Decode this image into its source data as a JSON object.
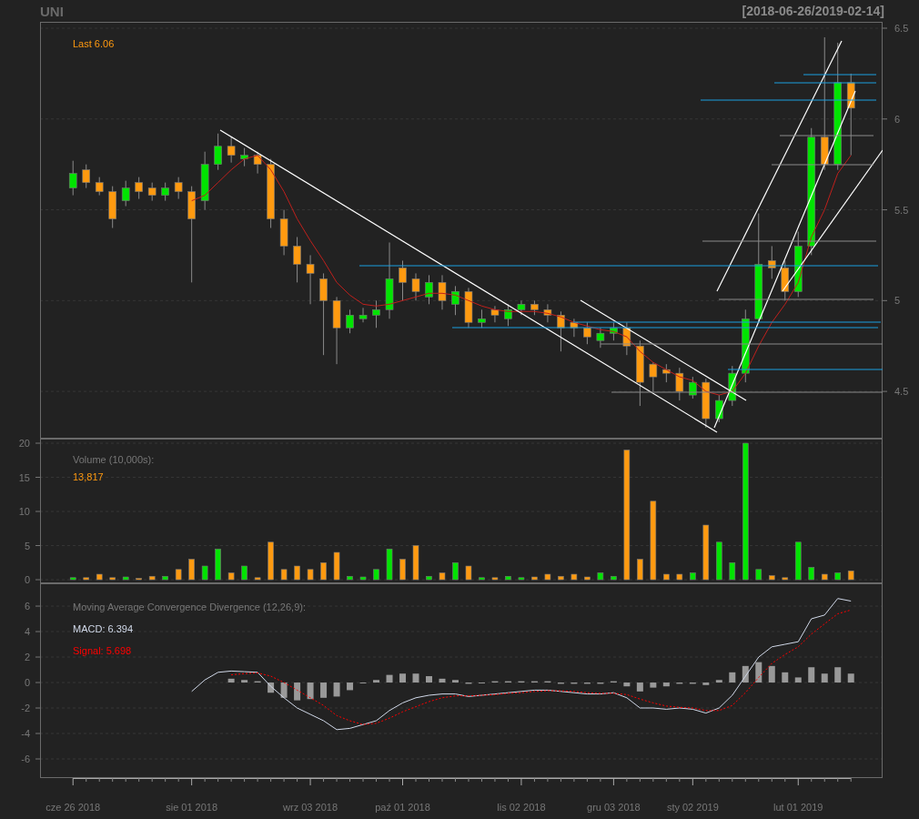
{
  "header": {
    "symbol": "UNI",
    "range": "[2018-06-26/2019-02-14]"
  },
  "price_panel": {
    "legend": "Last 6.06",
    "chart_data": {
      "type": "candlestick",
      "grid": true,
      "ylim": [
        4.24,
        6.535
      ],
      "yticks": [
        4.5,
        5.0,
        5.5,
        6.0,
        6.5
      ],
      "ohlc": [
        [
          5.62,
          5.77,
          5.58,
          5.7
        ],
        [
          5.72,
          5.75,
          5.62,
          5.65
        ],
        [
          5.65,
          5.68,
          5.58,
          5.6
        ],
        [
          5.6,
          5.63,
          5.4,
          5.45
        ],
        [
          5.55,
          5.66,
          5.52,
          5.62
        ],
        [
          5.65,
          5.68,
          5.56,
          5.6
        ],
        [
          5.62,
          5.65,
          5.55,
          5.58
        ],
        [
          5.58,
          5.65,
          5.55,
          5.62
        ],
        [
          5.65,
          5.68,
          5.56,
          5.6
        ],
        [
          5.6,
          5.63,
          5.1,
          5.45
        ],
        [
          5.55,
          5.82,
          5.5,
          5.75
        ],
        [
          5.75,
          5.92,
          5.72,
          5.85
        ],
        [
          5.85,
          5.9,
          5.76,
          5.8
        ],
        [
          5.78,
          5.84,
          5.74,
          5.8
        ],
        [
          5.8,
          5.82,
          5.7,
          5.75
        ],
        [
          5.75,
          5.78,
          5.4,
          5.45
        ],
        [
          5.45,
          5.5,
          5.25,
          5.3
        ],
        [
          5.3,
          5.35,
          5.1,
          5.2
        ],
        [
          5.2,
          5.25,
          4.98,
          5.15
        ],
        [
          5.12,
          5.15,
          4.7,
          5.0
        ],
        [
          5.0,
          5.02,
          4.65,
          4.85
        ],
        [
          4.85,
          4.95,
          4.82,
          4.92
        ],
        [
          4.9,
          4.96,
          4.88,
          4.92
        ],
        [
          4.92,
          5.0,
          4.85,
          4.95
        ],
        [
          4.95,
          5.32,
          4.9,
          5.12
        ],
        [
          5.18,
          5.22,
          5.0,
          5.1
        ],
        [
          5.12,
          5.15,
          5.0,
          5.05
        ],
        [
          5.02,
          5.14,
          4.98,
          5.1
        ],
        [
          5.1,
          5.14,
          4.95,
          5.0
        ],
        [
          4.98,
          5.08,
          4.92,
          5.05
        ],
        [
          5.05,
          5.07,
          4.85,
          4.88
        ],
        [
          4.88,
          4.95,
          4.85,
          4.9
        ],
        [
          4.95,
          4.97,
          4.88,
          4.92
        ],
        [
          4.9,
          4.98,
          4.86,
          4.95
        ],
        [
          4.95,
          5.0,
          4.92,
          4.98
        ],
        [
          4.98,
          5.0,
          4.92,
          4.95
        ],
        [
          4.95,
          4.98,
          4.88,
          4.92
        ],
        [
          4.92,
          4.94,
          4.72,
          4.85
        ],
        [
          4.88,
          4.9,
          4.8,
          4.85
        ],
        [
          4.85,
          4.88,
          4.76,
          4.8
        ],
        [
          4.78,
          4.85,
          4.74,
          4.82
        ],
        [
          4.82,
          4.88,
          4.78,
          4.85
        ],
        [
          4.85,
          4.88,
          4.7,
          4.75
        ],
        [
          4.75,
          4.78,
          4.42,
          4.55
        ],
        [
          4.65,
          4.66,
          4.5,
          4.58
        ],
        [
          4.62,
          4.65,
          4.55,
          4.6
        ],
        [
          4.6,
          4.63,
          4.45,
          4.5
        ],
        [
          4.48,
          4.58,
          4.46,
          4.55
        ],
        [
          4.55,
          4.57,
          4.3,
          4.35
        ],
        [
          4.35,
          4.48,
          4.33,
          4.45
        ],
        [
          4.45,
          4.64,
          4.42,
          4.6
        ],
        [
          4.6,
          4.95,
          4.55,
          4.9
        ],
        [
          4.9,
          5.48,
          4.88,
          5.2
        ],
        [
          5.22,
          5.3,
          5.12,
          5.18
        ],
        [
          5.18,
          5.22,
          5.0,
          5.05
        ],
        [
          5.05,
          5.38,
          5.02,
          5.3
        ],
        [
          5.3,
          5.95,
          5.25,
          5.9
        ],
        [
          5.9,
          6.45,
          5.72,
          5.75
        ],
        [
          5.75,
          6.42,
          5.72,
          6.2
        ],
        [
          6.2,
          6.25,
          5.8,
          6.06
        ]
      ],
      "series": [
        {
          "type": "line",
          "color": "#c0201c",
          "values": [
            null,
            null,
            null,
            null,
            null,
            null,
            null,
            null,
            null,
            5.55,
            5.58,
            5.65,
            5.72,
            5.78,
            5.8,
            5.72,
            5.6,
            5.45,
            5.33,
            5.22,
            5.1,
            5.03,
            4.98,
            4.97,
            4.98,
            5.0,
            5.02,
            5.04,
            5.04,
            5.03,
            5.0,
            4.97,
            4.95,
            4.94,
            4.94,
            4.94,
            4.93,
            4.91,
            4.88,
            4.86,
            4.84,
            4.83,
            4.8,
            4.72,
            4.66,
            4.62,
            4.58,
            4.56,
            4.5,
            4.48,
            4.5,
            4.6,
            4.75,
            4.88,
            4.98,
            5.1,
            5.35,
            5.5,
            5.7,
            5.8
          ]
        }
      ]
    }
  },
  "volume_panel": {
    "legend_title": "Volume (10,000s):",
    "legend_value": "13,817",
    "chart_data": {
      "type": "bar",
      "grid": true,
      "ylim": [
        -0.53,
        20.67
      ],
      "yticks": [
        0,
        5,
        10,
        15,
        20
      ],
      "series": [
        {
          "color": "#00e400",
          "values": [
            0.3,
            null,
            null,
            null,
            0.4,
            null,
            null,
            0.5,
            null,
            null,
            2,
            4.5,
            null,
            2,
            null,
            null,
            null,
            null,
            null,
            null,
            null,
            0.5,
            0.4,
            1.5,
            4.5,
            null,
            null,
            0.5,
            null,
            2.5,
            null,
            0.3,
            null,
            0.5,
            0.3,
            null,
            null,
            null,
            null,
            null,
            1,
            0.5,
            null,
            null,
            null,
            null,
            null,
            1,
            null,
            5.5,
            2.5,
            20,
            1.5,
            null,
            null,
            5.5,
            1.8,
            null,
            1,
            null
          ]
        },
        {
          "color": "#ff9a10",
          "values": [
            null,
            0.3,
            0.8,
            0.3,
            null,
            0.2,
            0.5,
            null,
            1.5,
            3,
            null,
            null,
            1,
            null,
            0.3,
            5.5,
            1.5,
            2,
            1.5,
            2.5,
            4,
            null,
            null,
            null,
            null,
            3,
            5,
            null,
            1,
            null,
            2,
            null,
            0.3,
            null,
            null,
            0.4,
            0.8,
            0.5,
            0.8,
            0.4,
            null,
            null,
            19,
            3,
            11.5,
            0.8,
            0.8,
            null,
            8,
            null,
            null,
            null,
            null,
            0.6,
            0.3,
            null,
            null,
            0.8,
            null,
            1.3
          ]
        }
      ]
    }
  },
  "macd_panel": {
    "legend_title": "Moving Average Convergence Divergence (12,26,9):",
    "macd_label": "MACD: 6.394",
    "signal_label": "Signal: 5.698",
    "chart_data": {
      "type": "line",
      "grid": true,
      "ylim": [
        -7.5,
        7.79
      ],
      "yticks": [
        -6,
        -4,
        -2,
        0,
        2,
        4,
        6
      ],
      "categories": [
        "cze 26 2018",
        null,
        null,
        null,
        null,
        null,
        null,
        null,
        null,
        "sie 01 2018",
        null,
        null,
        null,
        null,
        null,
        null,
        null,
        null,
        "wrz 03 2018",
        null,
        null,
        null,
        null,
        null,
        null,
        "paź 01 2018",
        null,
        null,
        null,
        null,
        null,
        null,
        null,
        null,
        "lis 02 2018",
        null,
        null,
        null,
        null,
        null,
        null,
        "gru 03 2018",
        null,
        null,
        null,
        null,
        null,
        "sty 02 2019",
        null,
        null,
        null,
        null,
        null,
        null,
        null,
        "lut 01 2019",
        null,
        null,
        null,
        null
      ],
      "series": [
        {
          "type": "bar",
          "color": "#999999",
          "values": [
            null,
            null,
            null,
            null,
            null,
            null,
            null,
            null,
            null,
            null,
            null,
            null,
            0.3,
            0.2,
            0.1,
            -0.8,
            -1.2,
            -1.4,
            -1.3,
            -1.2,
            -1.1,
            -0.6,
            0,
            0.2,
            0.6,
            0.7,
            0.7,
            0.5,
            0.3,
            0.2,
            -0.1,
            0,
            0.1,
            0.1,
            0.1,
            0.1,
            0.1,
            -0.1,
            -0.1,
            -0.1,
            -0.1,
            0.1,
            -0.3,
            -0.7,
            -0.4,
            -0.3,
            -0.1,
            -0.1,
            -0.2,
            0.2,
            0.8,
            1.3,
            1.6,
            1.3,
            0.8,
            0.4,
            1.2,
            0.7,
            1.2,
            0.7
          ]
        },
        {
          "type": "line",
          "color": "#d0d8e8",
          "values": [
            null,
            null,
            null,
            null,
            null,
            null,
            null,
            null,
            null,
            -0.7,
            0.2,
            0.8,
            0.9,
            0.85,
            0.8,
            -0.3,
            -1.2,
            -2,
            -2.5,
            -3,
            -3.7,
            -3.6,
            -3.3,
            -3,
            -2.2,
            -1.6,
            -1.2,
            -1,
            -0.9,
            -0.9,
            -1.1,
            -1,
            -0.9,
            -0.8,
            -0.7,
            -0.6,
            -0.6,
            -0.7,
            -0.8,
            -0.9,
            -0.9,
            -0.8,
            -1.2,
            -2,
            -2,
            -2.1,
            -2,
            -2.1,
            -2.4,
            -2,
            -1,
            0.5,
            2,
            2.8,
            3,
            3.2,
            5,
            5.3,
            6.6,
            6.4
          ]
        },
        {
          "type": "line",
          "line_style": "dashed",
          "color": "#ff0000",
          "values": [
            null,
            null,
            null,
            null,
            null,
            null,
            null,
            null,
            null,
            null,
            null,
            null,
            0.6,
            0.7,
            0.75,
            0.5,
            0,
            -0.6,
            -1.2,
            -1.8,
            -2.6,
            -3,
            -3.3,
            -3.2,
            -2.8,
            -2.3,
            -1.9,
            -1.5,
            -1.2,
            -1.05,
            -1.05,
            -1,
            -0.95,
            -0.85,
            -0.8,
            -0.7,
            -0.65,
            -0.65,
            -0.7,
            -0.8,
            -0.85,
            -0.85,
            -0.95,
            -1.3,
            -1.6,
            -1.85,
            -1.95,
            -2,
            -2.2,
            -2.2,
            -1.8,
            -0.8,
            0.4,
            1.5,
            2.2,
            2.8,
            3.8,
            4.6,
            5.4,
            5.7
          ]
        }
      ]
    }
  }
}
